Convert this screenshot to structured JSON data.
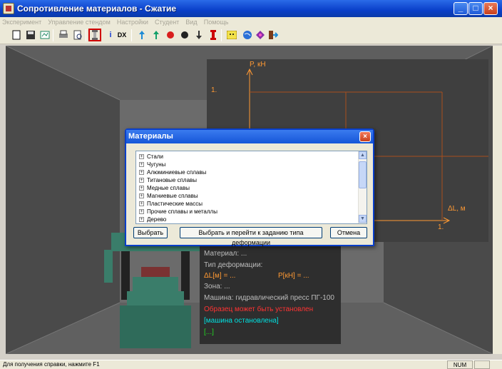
{
  "window": {
    "title": "Сопротивление материалов - Сжатие"
  },
  "menu": [
    "Эксперимент",
    "Управление стендом",
    "Настройки",
    "Студент",
    "Вид",
    "Помощь"
  ],
  "toolbar": {
    "buttons": [
      "new-icon",
      "save-icon",
      "export-icon",
      "print-icon",
      "print-preview-icon",
      "specimen-icon",
      "info-icon",
      "dx-icon",
      "arrow-up-icon",
      "arrow-up-alt-icon",
      "red-dot-icon",
      "black-dot-icon",
      "arrow-down-icon",
      "red-specimen-icon",
      "smiley-icon",
      "globe-icon",
      "book-icon",
      "exit-icon"
    ],
    "info_label": "i",
    "dx_label": "DX"
  },
  "graph": {
    "y_axis": "P, кН",
    "x_axis": "ΔL, м",
    "y_tick": "1.",
    "x_tick": "1."
  },
  "info": {
    "material": "Материал: ...",
    "deformation": "Тип деформации:",
    "delta": "ΔL[м] = ...",
    "force": "P[кН] = ...",
    "zone": "Зона: ...",
    "machine": "Машина:    гидравлический пресс ПГ-100",
    "warning": "Образец может быть установлен",
    "status": "[машина остановлена]",
    "bracket": "[...]"
  },
  "dialog": {
    "title": "Материалы",
    "items": [
      "Стали",
      "Чугуны",
      "Алюминиевые сплавы",
      "Титановые сплавы",
      "Медные сплавы",
      "Магниевые сплавы",
      "Пластические массы",
      "Прочие сплавы и металлы",
      "Дерево"
    ],
    "btn_select": "Выбрать",
    "btn_select_go": "Выбрать и перейти к заданию типа деформации",
    "btn_cancel": "Отмена"
  },
  "status": {
    "message": "Для получения справки, нажмите F1",
    "num": "NUM"
  },
  "colors": {
    "titlebar": "#0a3fc9",
    "graph_axis": "#ff9933",
    "warning": "#ff3333",
    "status": "#00e0e0",
    "machine": "#3a7d6a"
  }
}
